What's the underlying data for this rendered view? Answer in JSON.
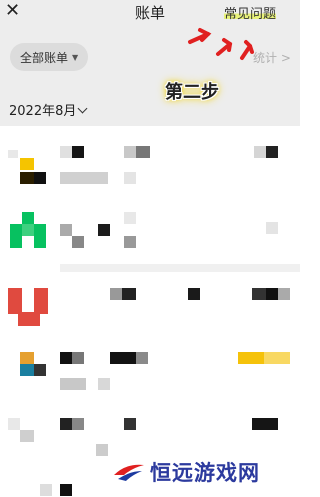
{
  "header": {
    "close_icon": "close-icon",
    "title": "账单",
    "faq_label": "常见问题",
    "all_bills_label": "全部账单",
    "stats_label": "统计 >",
    "step_annotation": "第二步"
  },
  "month_label": "2022年8月",
  "watermark_text": "恒远游戏网",
  "colors": {
    "header_bg": "#ededed",
    "arrow_red": "#e02020",
    "highlight_yellow": "#e8f27a",
    "wechat_green": "#07c160",
    "red_icon": "#e04a3f",
    "orange_icon": "#e5a030",
    "blue_icon": "#1a7fa0",
    "yellow_amount": "#f5c20a"
  }
}
